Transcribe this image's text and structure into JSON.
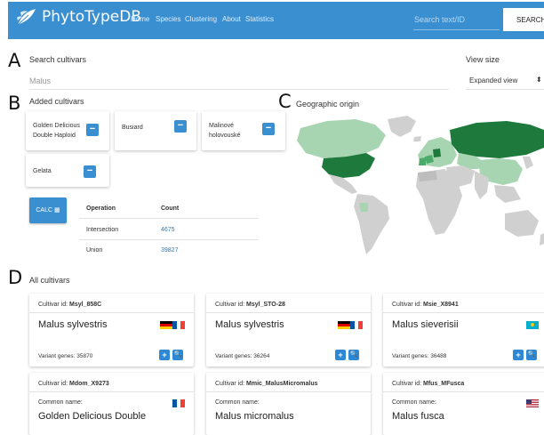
{
  "navbar": {
    "brand": "PhytoTypeDB",
    "links": [
      "Home",
      "Species",
      "Clustering",
      "About",
      "Statistics"
    ],
    "search_placeholder": "Search text/ID",
    "search_button": "SEARCH"
  },
  "panels": {
    "a": "A",
    "b": "B",
    "c": "C",
    "d": "D"
  },
  "search_section": {
    "label": "Search cultivars",
    "value": "Malus",
    "view_size_label": "View size",
    "view_size_value": "Expanded view",
    "view_size_arrow": "⬍"
  },
  "added_cultivars": {
    "title": "Added cultivars",
    "items": [
      {
        "name": "Golden Delicious Double Haploid"
      },
      {
        "name": "Busiard"
      },
      {
        "name": "Malinové holovouské"
      },
      {
        "name": "Gelata"
      }
    ],
    "remove_symbol": "−"
  },
  "operations": {
    "calc_label": "CALC",
    "calc_icon": "▦",
    "headers": {
      "operation": "Operation",
      "count": "Count"
    },
    "rows": [
      {
        "operation": "Intersection",
        "count": "4675"
      },
      {
        "operation": "Union",
        "count": "39827"
      }
    ]
  },
  "map": {
    "title": "Geographic origin",
    "colors": {
      "none": "#d0d0d0",
      "light": "#a8d5b1",
      "mid": "#4caa6a",
      "dark": "#1e7a3c"
    }
  },
  "all_cultivars": {
    "title": "All cultivars",
    "id_prefix": "Cultivar id: ",
    "variant_prefix": "Variant genes: ",
    "common_label": "Common name:",
    "add_symbol": "+",
    "view_symbol": "🔍",
    "cards": [
      {
        "id": "Msyl_858C",
        "name": "Malus sylvestris",
        "variant": "35870",
        "flags": [
          "de",
          "fr"
        ]
      },
      {
        "id": "Msyl_STO-28",
        "name": "Malus sylvestris",
        "variant": "36264",
        "flags": [
          "de",
          "fr"
        ]
      },
      {
        "id": "Msie_X8941",
        "name": "Malus sieverisii",
        "variant": "36488",
        "flags": [
          "kz"
        ]
      },
      {
        "id": "Mdom_X9273",
        "name": "Golden Delicious Double",
        "flags": [
          "fr"
        ]
      },
      {
        "id": "Mmic_MalusMicromalus",
        "name": "Malus micromalus",
        "flags": []
      },
      {
        "id": "Mfus_MFusca",
        "name": "Malus fusca",
        "flags": [
          "us"
        ]
      }
    ]
  }
}
